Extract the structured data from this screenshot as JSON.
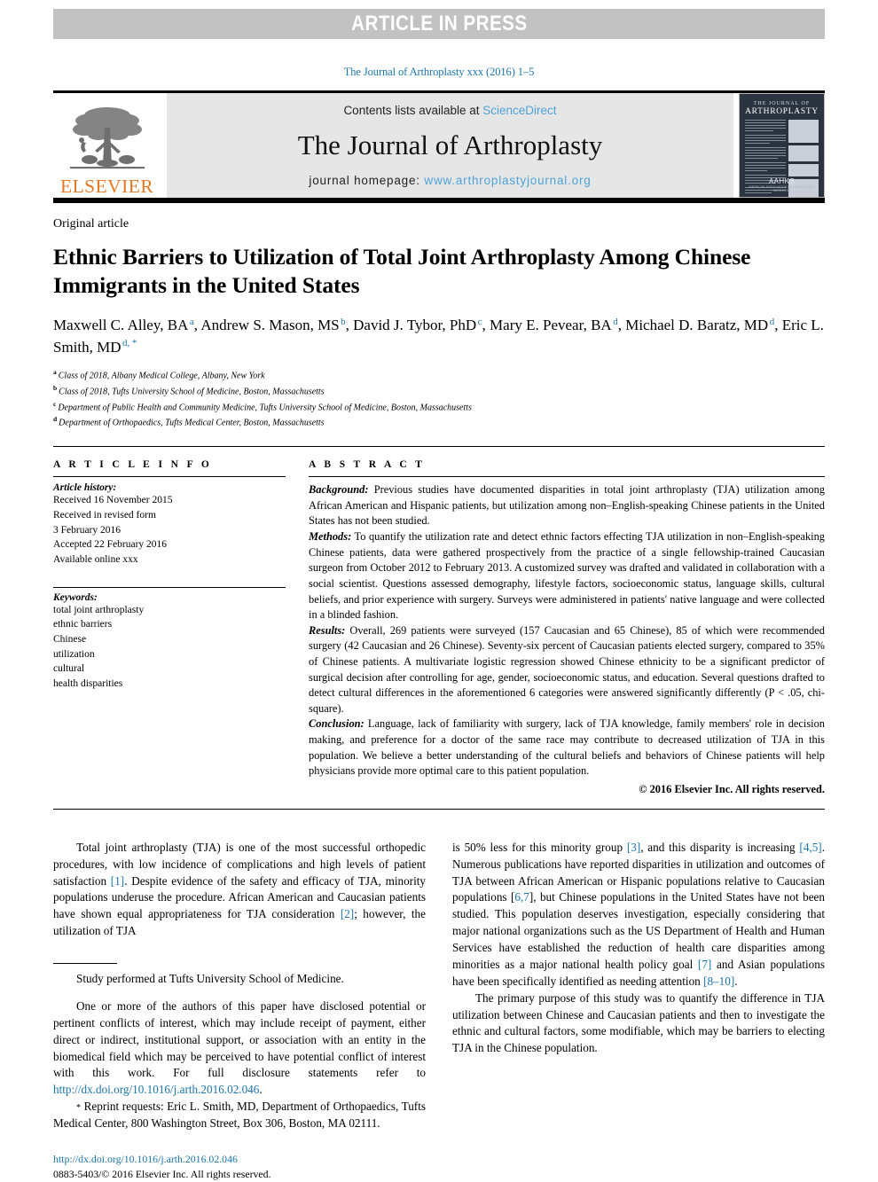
{
  "banner": {
    "text": "ARTICLE IN PRESS"
  },
  "running_head": "The Journal of Arthroplasty xxx (2016) 1–5",
  "masthead": {
    "contents_prefix": "Contents lists available at ",
    "sciencedirect": "ScienceDirect",
    "journal_title": "The Journal of Arthroplasty",
    "homepage_prefix": "journal homepage: ",
    "homepage_url": "www.arthroplastyjournal.org",
    "elsevier_word": "ELSEVIER",
    "cover": {
      "line1": "THE JOURNAL OF",
      "line2": "ARTHROPLASTY",
      "society": "AAHKS",
      "society_sub": "AMERICAN ASSOCIATION OF HIP AND KNEE SURGEONS"
    }
  },
  "article": {
    "type": "Original article",
    "title": "Ethnic Barriers to Utilization of Total Joint Arthroplasty Among Chinese Immigrants in the United States",
    "authors": [
      {
        "name": "Maxwell C. Alley, BA",
        "sup": "a",
        "sep": ", "
      },
      {
        "name": "Andrew S. Mason, MS",
        "sup": "b",
        "sep": ", "
      },
      {
        "name": "David J. Tybor, PhD",
        "sup": "c",
        "sep": ", "
      },
      {
        "name": "Mary E. Pevear, BA",
        "sup": "d",
        "sep": ", "
      },
      {
        "name": "Michael D. Baratz, MD",
        "sup": "d",
        "sep": ", "
      },
      {
        "name": "Eric L. Smith, MD",
        "sup": "d, *",
        "sep": ""
      }
    ],
    "affiliations": [
      {
        "mark": "a",
        "text": "Class of 2018, Albany Medical College, Albany, New York"
      },
      {
        "mark": "b",
        "text": "Class of 2018, Tufts University School of Medicine, Boston, Massachusetts"
      },
      {
        "mark": "c",
        "text": "Department of Public Health and Community Medicine, Tufts University School of Medicine, Boston, Massachusetts"
      },
      {
        "mark": "d",
        "text": "Department of Orthopaedics, Tufts Medical Center, Boston, Massachusetts"
      }
    ]
  },
  "article_info": {
    "heading": "A R T I C L E   I N F O",
    "history_label": "Article history:",
    "history": [
      "Received 16 November 2015",
      "Received in revised form",
      "3 February 2016",
      "Accepted 22 February 2016",
      "Available online xxx"
    ],
    "keywords_label": "Keywords:",
    "keywords": [
      "total joint arthroplasty",
      "ethnic barriers",
      "Chinese",
      "utilization",
      "cultural",
      "health disparities"
    ]
  },
  "abstract": {
    "heading": "A B S T R A C T",
    "sections": [
      {
        "label": "Background:",
        "text": " Previous studies have documented disparities in total joint arthroplasty (TJA) utilization among African American and Hispanic patients, but utilization among non–English-speaking Chinese patients in the United States has not been studied."
      },
      {
        "label": "Methods:",
        "text": " To quantify the utilization rate and detect ethnic factors effecting TJA utilization in non–English-speaking Chinese patients, data were gathered prospectively from the practice of a single fellowship-trained Caucasian surgeon from October 2012 to February 2013. A customized survey was drafted and validated in collaboration with a social scientist. Questions assessed demography, lifestyle factors, socioeconomic status, language skills, cultural beliefs, and prior experience with surgery. Surveys were administered in patients' native language and were collected in a blinded fashion."
      },
      {
        "label": "Results:",
        "text": " Overall, 269 patients were surveyed (157 Caucasian and 65 Chinese), 85 of which were recommended surgery (42 Caucasian and 26 Chinese). Seventy-six percent of Caucasian patients elected surgery, compared to 35% of Chinese patients. A multivariate logistic regression showed Chinese ethnicity to be a significant predictor of surgical decision after controlling for age, gender, socioeconomic status, and education. Several questions drafted to detect cultural differences in the aforementioned 6 categories were answered significantly differently (P < .05, chi-square)."
      },
      {
        "label": "Conclusion:",
        "text": " Language, lack of familiarity with surgery, lack of TJA knowledge, family members' role in decision making, and preference for a doctor of the same race may contribute to decreased utilization of TJA in this population. We believe a better understanding of the cultural beliefs and behaviors of Chinese patients will help physicians provide more optimal care to this patient population."
      }
    ],
    "copyright": "© 2016 Elsevier Inc. All rights reserved."
  },
  "body": {
    "left_paragraph_1": "Total joint arthroplasty (TJA) is one of the most successful orthopedic procedures, with low incidence of complications and high levels of patient satisfaction ",
    "left_ref_1": "[1]",
    "left_paragraph_1b": ". Despite evidence of the safety and efficacy of TJA, minority populations underuse the procedure. African American and Caucasian patients have shown equal appropriateness for TJA consideration ",
    "left_ref_2": "[2]",
    "left_paragraph_1c": "; however, the utilization of TJA",
    "right_paragraph_1a": "is 50% less for this minority group ",
    "right_ref_3": "[3]",
    "right_paragraph_1b": ", and this disparity is increasing ",
    "right_ref_45": "[4,5]",
    "right_paragraph_1c": ". Numerous publications have reported disparities in utilization and outcomes of TJA between African American or Hispanic populations relative to Caucasian populations [",
    "right_ref_67": "6,7",
    "right_paragraph_1d": "], but Chinese populations in the United States have not been studied. This population deserves investigation, especially considering that major national organizations such as the US Department of Health and Human Services have established the reduction of health care disparities among minorities as a major national health policy goal ",
    "right_ref_7": "[7]",
    "right_paragraph_1e": " and Asian populations have been specifically identified as needing attention ",
    "right_ref_810": "[8–10]",
    "right_paragraph_1f": ".",
    "right_paragraph_2": "The primary purpose of this study was to quantify the difference in TJA utilization between Chinese and Caucasian patients and then to investigate the ethnic and cultural factors, some modifiable, which may be barriers to electing TJA in the Chinese population."
  },
  "footnotes": {
    "study_note": "Study performed at Tufts University School of Medicine.",
    "disclosure_a": "One or more of the authors of this paper have disclosed potential or pertinent conflicts of interest, which may include receipt of payment, either direct or indirect, institutional support, or association with an entity in the biomedical field which may be perceived to have potential conflict of interest with this work. For full disclosure statements refer to ",
    "disclosure_link": "http://dx.doi.org/10.1016/j.arth.2016.02.046",
    "disclosure_end": ".",
    "reprint_star": "*",
    "reprint": " Reprint requests: Eric L. Smith, MD, Department of Orthopaedics, Tufts Medical Center, 800 Washington Street, Box 306, Boston, MA 02111.",
    "doi_link": "http://dx.doi.org/10.1016/j.arth.2016.02.046",
    "issn_line": "0883-5403/© 2016 Elsevier Inc. All rights reserved."
  },
  "colors": {
    "link": "#1c75a8",
    "banner_bg": "#c2c2c2",
    "masthead_bg": "#e6e6e6",
    "elsevier_orange": "#e87722",
    "sciencedirect_blue": "#4ea3d6"
  }
}
